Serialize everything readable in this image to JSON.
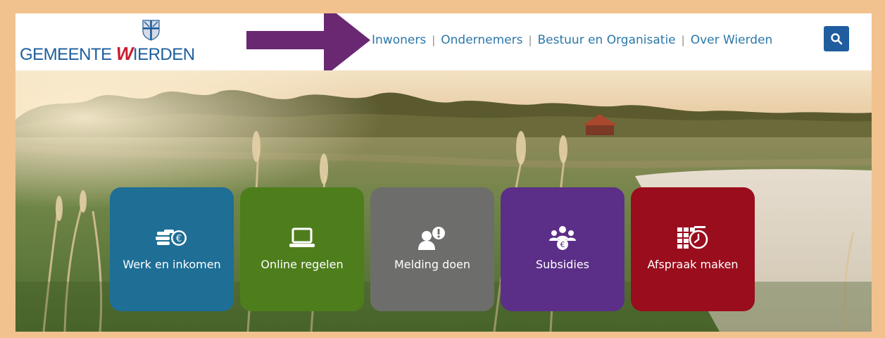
{
  "brand": {
    "name_prefix": "GEMEENTE ",
    "name_initial": "W",
    "name_rest": "IERDEN",
    "primary_color": "#1c5d9c",
    "accent_color": "#c81d2e"
  },
  "annotation": {
    "arrow_color": "#6a2872",
    "frame_color": "#f1c28e"
  },
  "nav": {
    "items": [
      {
        "label": "Inwoners"
      },
      {
        "label": "Ondernemers"
      },
      {
        "label": "Bestuur en Organisatie"
      },
      {
        "label": "Over Wierden"
      }
    ],
    "separator": "|"
  },
  "search": {
    "icon": "search-icon",
    "color": "#1f5d9e"
  },
  "tiles": [
    {
      "label": "Werk en inkomen",
      "icon": "coins-euro-icon",
      "color": "#1e6e96"
    },
    {
      "label": "Online regelen",
      "icon": "laptop-icon",
      "color": "#4e7e1c"
    },
    {
      "label": "Melding doen",
      "icon": "person-alert-icon",
      "color": "#6d6e6b"
    },
    {
      "label": "Subsidies",
      "icon": "group-euro-icon",
      "color": "#5b2f87"
    },
    {
      "label": "Afspraak maken",
      "icon": "calendar-clock-icon",
      "color": "#9a0d1d"
    }
  ]
}
